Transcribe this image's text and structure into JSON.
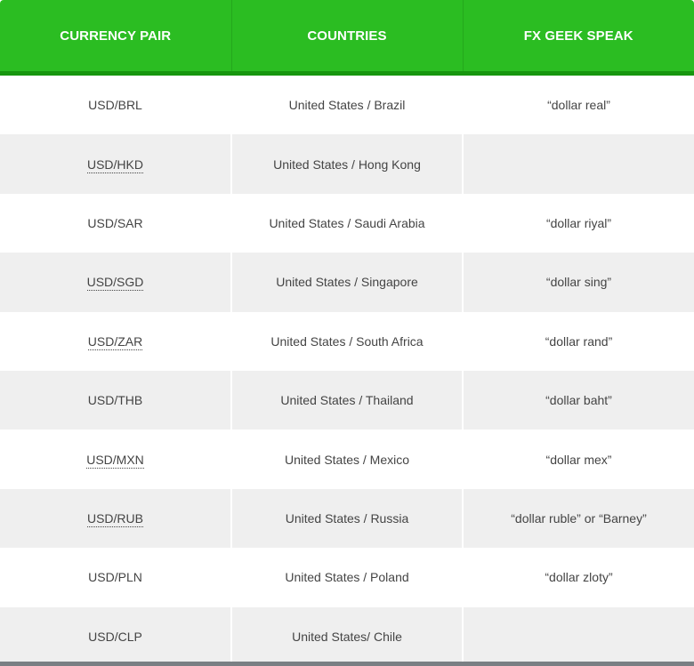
{
  "table": {
    "headers": [
      "CURRENCY PAIR",
      "COUNTRIES",
      "FX GEEK SPEAK"
    ],
    "rows": [
      {
        "pair": "USD/BRL",
        "pair_linked": false,
        "countries": "United States / Brazil",
        "geek": "“dollar real”"
      },
      {
        "pair": "USD/HKD",
        "pair_linked": true,
        "countries": "United States / Hong Kong",
        "geek": ""
      },
      {
        "pair": "USD/SAR",
        "pair_linked": false,
        "countries": "United States / Saudi Arabia",
        "geek": "“dollar riyal”"
      },
      {
        "pair": "USD/SGD",
        "pair_linked": true,
        "countries": "United States / Singapore",
        "geek": "“dollar sing”"
      },
      {
        "pair": "USD/ZAR",
        "pair_linked": true,
        "countries": "United States / South Africa",
        "geek": "“dollar rand”"
      },
      {
        "pair": "USD/THB",
        "pair_linked": false,
        "countries": "United States / Thailand",
        "geek": "“dollar baht”"
      },
      {
        "pair": "USD/MXN",
        "pair_linked": true,
        "countries": "United States / Mexico",
        "geek": "“dollar mex”"
      },
      {
        "pair": "USD/RUB",
        "pair_linked": true,
        "countries": "United States / Russia",
        "geek": "“dollar ruble” or “Barney”"
      },
      {
        "pair": "USD/PLN",
        "pair_linked": false,
        "countries": "United States / Poland",
        "geek": "“dollar zloty”"
      },
      {
        "pair": "USD/CLP",
        "pair_linked": false,
        "countries": "United States/ Chile",
        "geek": ""
      }
    ]
  },
  "colors": {
    "header_bg": "#2bbd22",
    "header_border": "#17960f",
    "row_alt_bg": "#efefef",
    "text": "#444444"
  }
}
